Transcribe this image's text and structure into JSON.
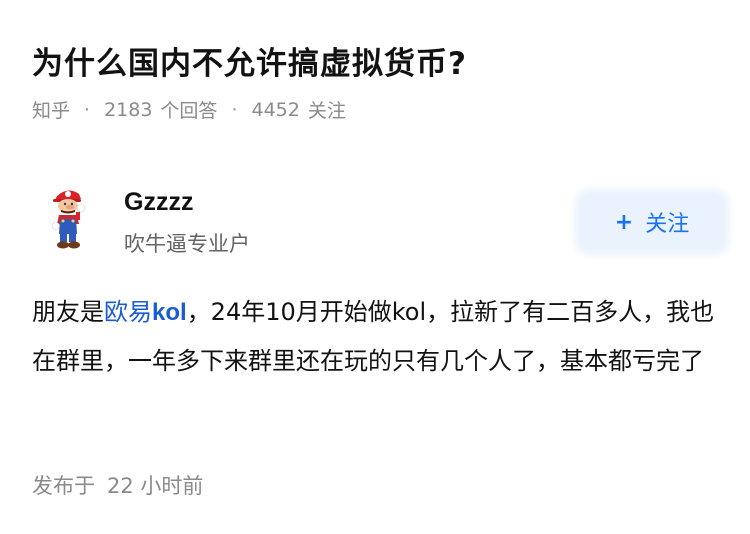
{
  "question": {
    "title": "为什么国内不允许搞虚拟货币?"
  },
  "meta": {
    "source": "知乎",
    "separator": "·",
    "answer_count": "2183",
    "answer_label": "个回答",
    "follower_count": "4452",
    "follower_label": "关注"
  },
  "author": {
    "name": "Gzzzz",
    "bio": "吹牛逼专业户",
    "avatar_icon": "mario-avatar-icon",
    "follow_button": {
      "plus": "+",
      "label": "关注"
    }
  },
  "answer": {
    "prefix": "朋友是",
    "link_text_1": "欧易",
    "link_text_2": "kol",
    "rest": "，24年10月开始做kol，拉新了有二百多人，我也在群里，一年多下来群里还在玩的只有几个人了，基本都亏完了"
  },
  "publish": {
    "label": "发布于",
    "time": "22 小时前"
  },
  "colors": {
    "link": "#1a5bd8",
    "follow_text": "#1772f6",
    "follow_bg": "#eaf2fd",
    "meta_text": "#8a8a8a"
  }
}
